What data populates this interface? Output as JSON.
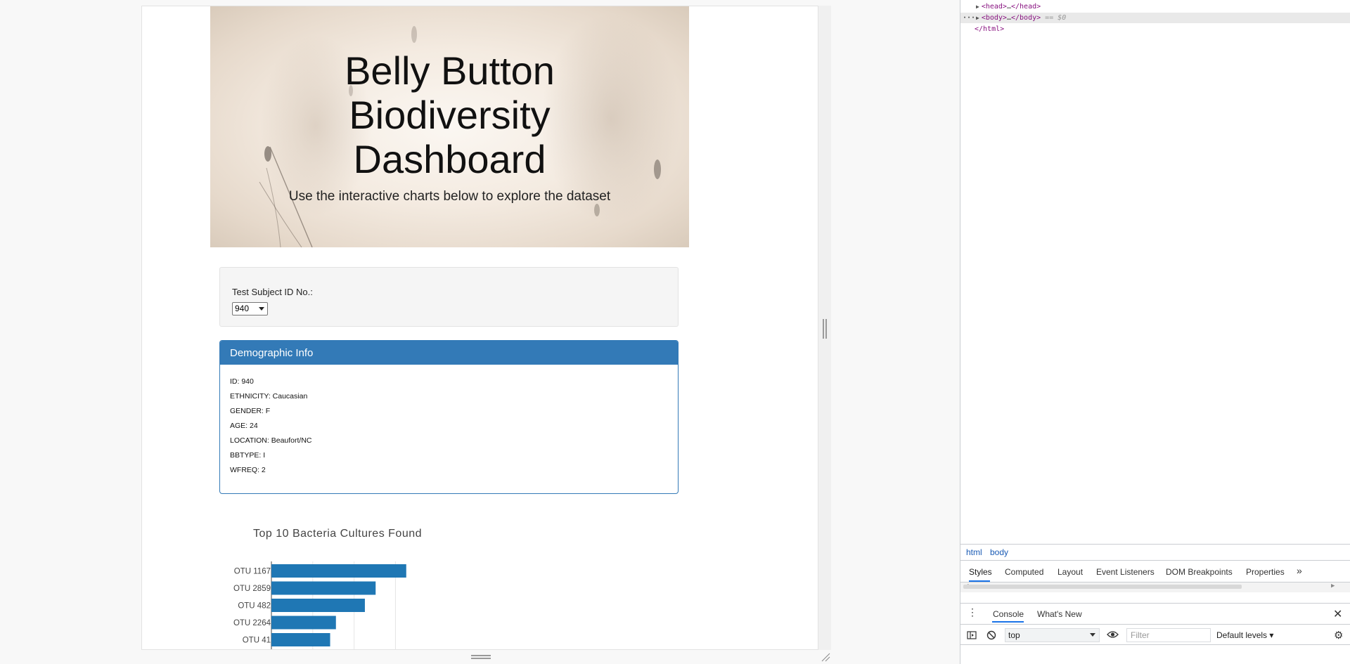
{
  "page": {
    "title_lines": [
      "Belly Button",
      "Biodiversity",
      "Dashboard"
    ],
    "subtitle": "Use the interactive charts below to explore the dataset",
    "selector": {
      "label": "Test Subject ID No.:",
      "selected": "940"
    },
    "demographic": {
      "heading": "Demographic Info",
      "rows": [
        "ID: 940",
        "ETHNICITY: Caucasian",
        "GENDER: F",
        "AGE: 24",
        "LOCATION: Beaufort/NC",
        "BBTYPE: I",
        "WFREQ: 2"
      ]
    }
  },
  "chart_data": {
    "type": "bar",
    "orientation": "horizontal",
    "title": "Top 10 Bacteria Cultures Found",
    "categories": [
      "OTU 1167",
      "OTU 2859",
      "OTU 482",
      "OTU 2264",
      "OTU 41"
    ],
    "values": [
      163,
      126,
      113,
      78,
      71
    ],
    "xlim": [
      0,
      170
    ],
    "grid": true,
    "bar_color": "#1f77b4"
  },
  "devtools": {
    "dom_lines": [
      {
        "open": "<head>",
        "dots": "…",
        "close": "</head>"
      },
      {
        "open": "<body>",
        "dots": "…",
        "close": "</body>",
        "suffix": "== $0"
      },
      {
        "text": "</html>"
      }
    ],
    "breadcrumbs": [
      "html",
      "body"
    ],
    "panel_tabs": [
      "Styles",
      "Computed",
      "Layout",
      "Event Listeners",
      "DOM Breakpoints",
      "Properties"
    ],
    "more_tabs": "»",
    "drawer_tabs": [
      "Console",
      "What's New"
    ],
    "context": "top",
    "filter_placeholder": "Filter",
    "levels": "Default levels ▾"
  },
  "colors": {
    "panel_primary": "#337ab7",
    "accent": "#1a73e8"
  }
}
